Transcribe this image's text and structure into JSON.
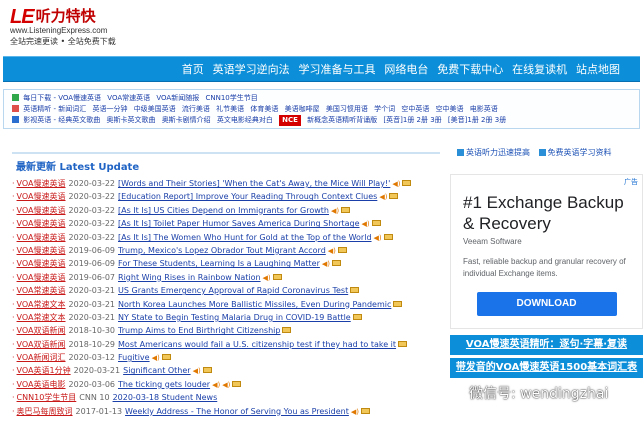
{
  "header": {
    "logo_mark": "LE",
    "logo_name": "听力特快",
    "logo_url": "www.ListeningExpress.com",
    "slogan": "全站完速更读 • 全站免费下载"
  },
  "nav": {
    "items": [
      "首页",
      "英语学习逆向法",
      "学习准备与工具",
      "网络电台",
      "免费下载中心",
      "在线复读机",
      "站点地图"
    ]
  },
  "quicklinks": {
    "rows": [
      {
        "color": "#2ea84a",
        "links": [
          "每日下载 - VOA慢速英语",
          "VOA常速英语",
          "VOA新闻随报",
          "CNN10学生节目"
        ]
      },
      {
        "color": "#e0504a",
        "links": [
          "英语精听 - 新闻词汇",
          "英语一分钟",
          "中级美国英语",
          "流行美语",
          "礼节美语",
          "体育美语",
          "美语咖啡屋",
          "美国习惯用语",
          "学个词",
          "空中英语",
          "空中美语",
          "电影英语"
        ]
      },
      {
        "color": "#2a6fd0",
        "links": [
          "影视英语 - 经典英文歌曲",
          "奥斯卡英文歌曲",
          "奥斯卡剧情介绍",
          "英文电影经典对白"
        ],
        "nce_label": "NCE",
        "extra": [
          "新概念英语精听背诵版",
          "[英音]1册 2册 3册",
          "[美音]1册 2册 3册"
        ]
      }
    ]
  },
  "main": {
    "section_title": "最新更新 Latest Update",
    "items": [
      {
        "cat": "VOA慢速英语",
        "date": "2020-03-22",
        "title": "[Words and Their Stories] 'When the Cat's Away, the Mice Will Play!'",
        "icons": [
          "sound",
          "img"
        ]
      },
      {
        "cat": "VOA慢速英语",
        "date": "2020-03-22",
        "title": "[Education Report] Improve Your Reading Through Context Clues",
        "icons": [
          "sound",
          "img"
        ]
      },
      {
        "cat": "VOA慢速英语",
        "date": "2020-03-22",
        "title": "[As It Is] US Cities Depend on Immigrants for Growth",
        "icons": [
          "sound",
          "img"
        ]
      },
      {
        "cat": "VOA慢速英语",
        "date": "2020-03-22",
        "title": "[As It Is] Toilet Paper Humor Saves America During Shortage",
        "icons": [
          "sound",
          "img"
        ]
      },
      {
        "cat": "VOA慢速英语",
        "date": "2020-03-22",
        "title": "[As It Is] The Women Who Hunt for Gold at the Top of the World",
        "icons": [
          "sound",
          "img"
        ]
      },
      {
        "cat": "VOA慢速英语",
        "date": "2019-06-09",
        "title": "Trump, Mexico's Lopez Obrador Tout Migrant Accord",
        "icons": [
          "sound",
          "img"
        ]
      },
      {
        "cat": "VOA慢速英语",
        "date": "2019-06-09",
        "title": "For These Students, Learning Is a Laughing Matter",
        "icons": [
          "sound",
          "img"
        ]
      },
      {
        "cat": "VOA慢速英语",
        "date": "2019-06-07",
        "title": "Right Wing Rises in Rainbow Nation",
        "icons": [
          "sound",
          "img"
        ]
      },
      {
        "cat": "VOA常速英语",
        "date": "2020-03-21",
        "title": "US Grants Emergency Approval of Rapid Coronavirus Test",
        "icons": [
          "img"
        ]
      },
      {
        "cat": "VOA常速文本",
        "date": "2020-03-21",
        "title": "North Korea Launches More Ballistic Missiles, Even During Pandemic",
        "icons": [
          "img"
        ]
      },
      {
        "cat": "VOA常速文本",
        "date": "2020-03-21",
        "title": "NY State to Begin Testing Malaria Drug in COVID-19 Battle",
        "icons": [
          "img"
        ]
      },
      {
        "cat": "VOA双语新闻",
        "date": "2018-10-30",
        "title": "Trump Aims to End Birthright Citizenship",
        "icons": [
          "img"
        ]
      },
      {
        "cat": "VOA双语新闻",
        "date": "2018-10-29",
        "title": "Most Americans would fail a U.S. citizenship test if they had to take it",
        "icons": [
          "img"
        ]
      },
      {
        "cat": "VOA新闻词汇",
        "date": "2020-03-12",
        "title": "Fugitive",
        "icons": [
          "sound",
          "img"
        ]
      },
      {
        "cat": "VOA英语1分钟",
        "date": "2020-03-21",
        "title": "Significant Other",
        "icons": [
          "sound",
          "img"
        ]
      },
      {
        "cat": "VOA英语电影",
        "date": "2020-03-06",
        "title": "The ticking gets louder",
        "icons": [
          "sound",
          "sound",
          "img"
        ]
      },
      {
        "cat": "CNN10学生节目",
        "date": "CNN 10",
        "title": "2020-03-18 Student News",
        "icons": []
      },
      {
        "cat": "奥巴马每周致词",
        "date": "2017-01-13",
        "title": "Weekly Address - The Honor of Serving You as President",
        "icons": [
          "sound",
          "img"
        ]
      }
    ]
  },
  "sidebar": {
    "top_links": [
      "英语听力迅速提高",
      "免费英语学习资料"
    ],
    "ad": {
      "choice": "广告",
      "headline": "#1 Exchange Backup & Recovery",
      "vendor": "Veeam Software",
      "description": "Fast, reliable backup and granular recovery of individual Exchange items.",
      "button": "DOWNLOAD"
    },
    "banners": [
      "VOA慢速英语精听：逐句·字幕·复读",
      "带发音的VOA慢速英语1500基本词汇表"
    ]
  },
  "watermark": {
    "text": "微信号: wendingzhai"
  },
  "colors": {
    "nav_blue": "#0c8fd8",
    "category_red": "#c81818",
    "link_blue": "#1a3fa8"
  }
}
